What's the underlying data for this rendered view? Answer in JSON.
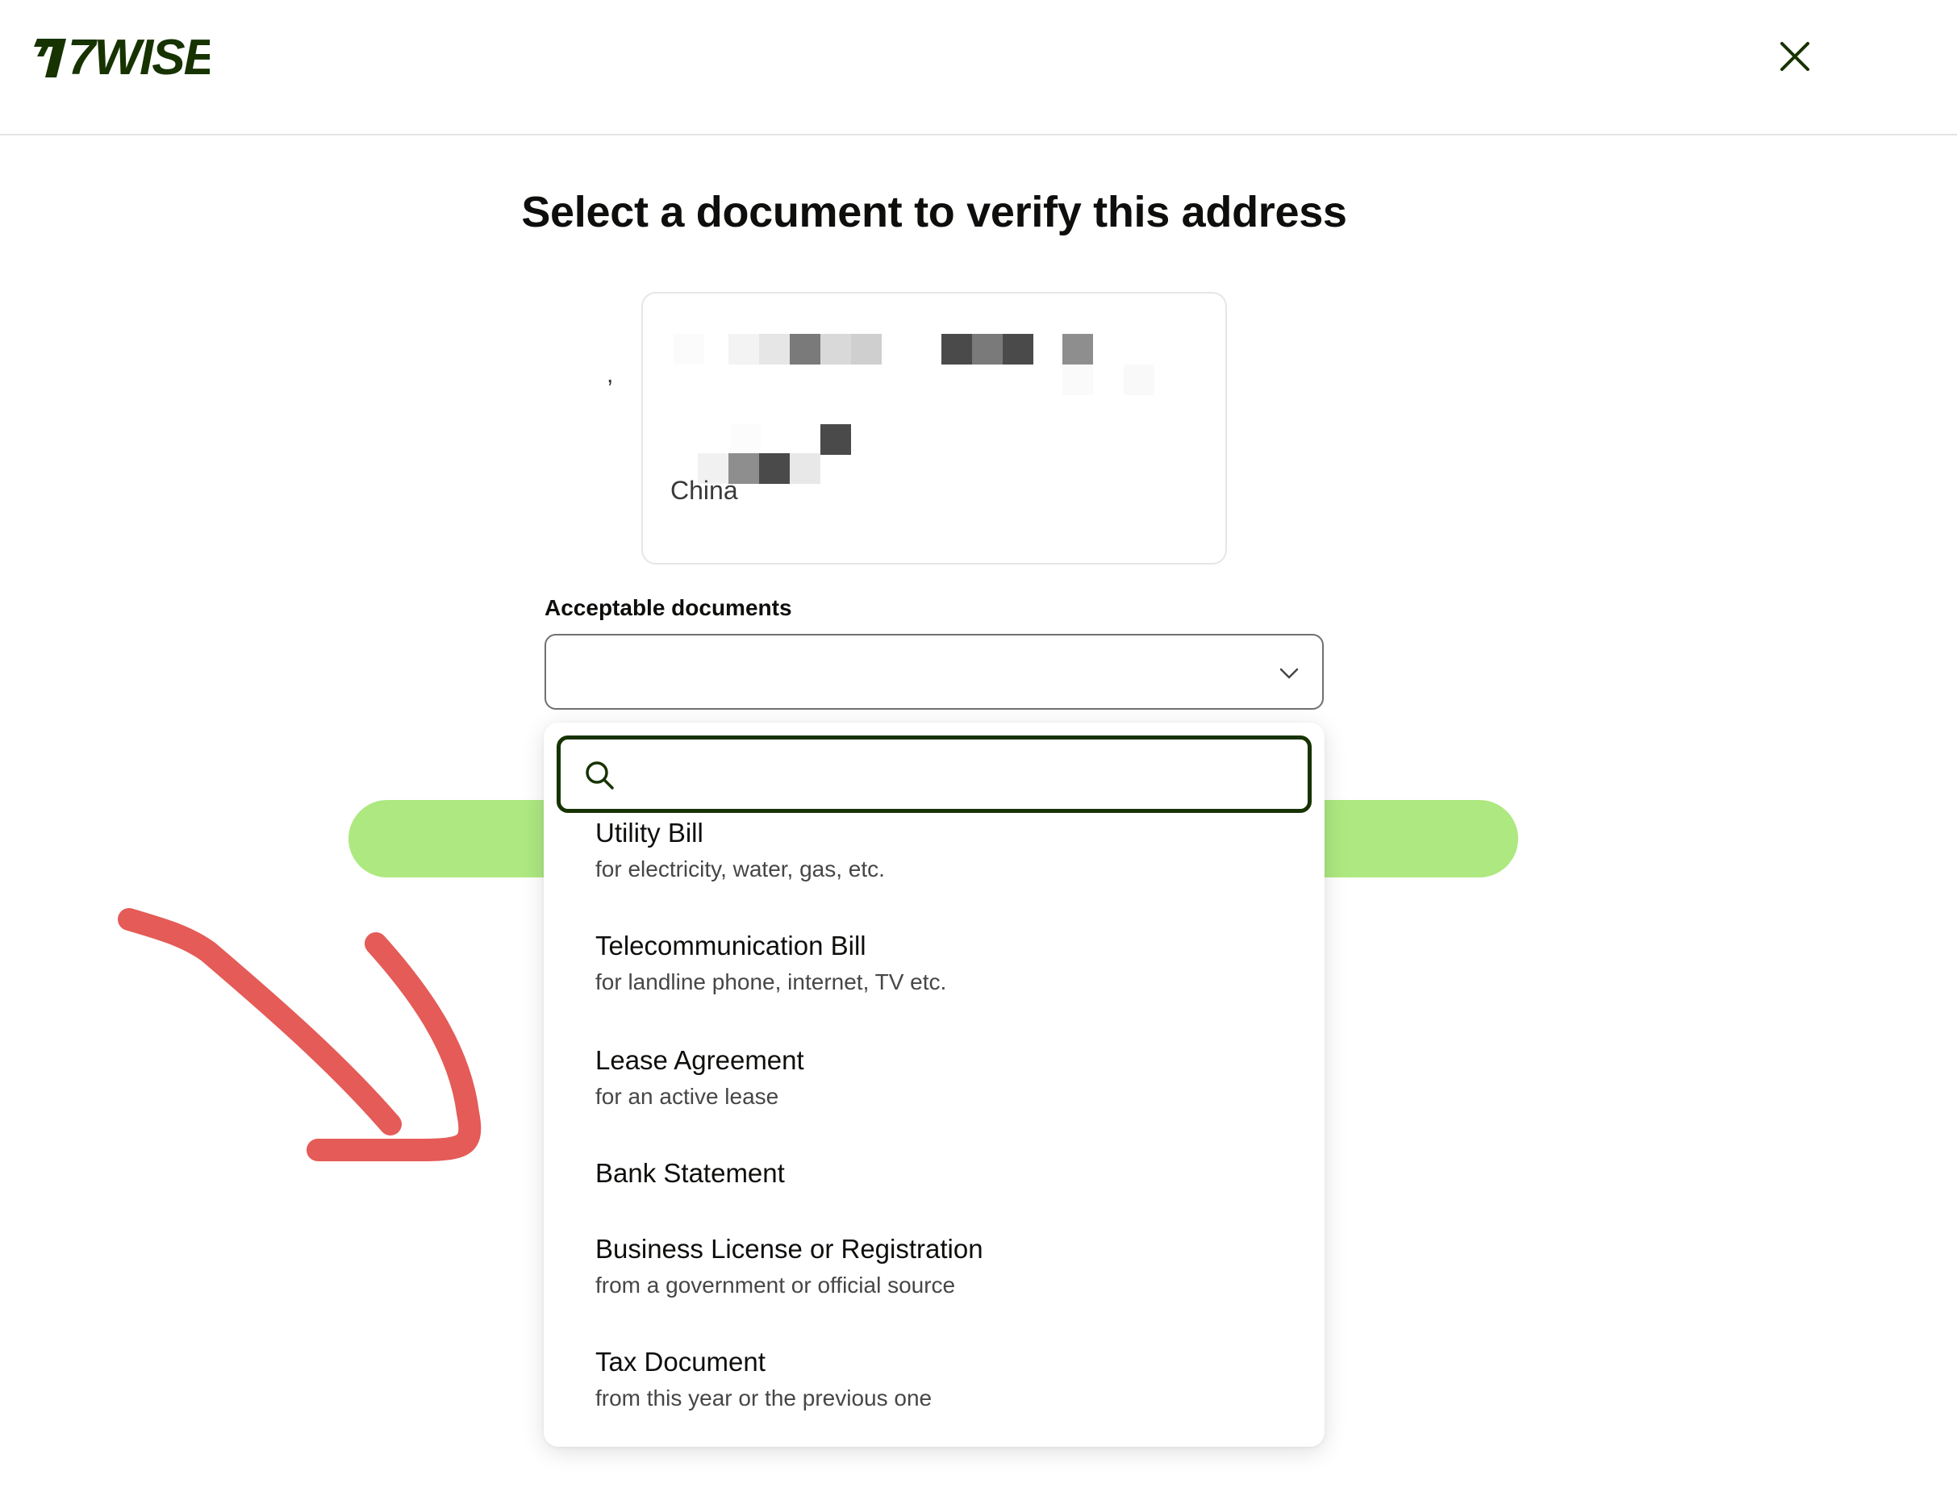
{
  "header": {
    "logo_text": "7WISE",
    "close_label": "×"
  },
  "page": {
    "title": "Select a document to verify this address"
  },
  "address": {
    "country": "China",
    "trailing_comma": ","
  },
  "documents_field": {
    "label": "Acceptable documents",
    "value": ""
  },
  "dropdown": {
    "search_placeholder": "",
    "options": [
      {
        "title": "Utility Bill",
        "subtitle": "for electricity, water, gas, etc."
      },
      {
        "title": "Telecommunication Bill",
        "subtitle": "for landline phone, internet, TV etc."
      },
      {
        "title": "Lease Agreement",
        "subtitle": "for an active lease"
      },
      {
        "title": "Bank Statement",
        "subtitle": ""
      },
      {
        "title": "Business License or Registration",
        "subtitle": "from a government or official source"
      },
      {
        "title": "Tax Document",
        "subtitle": "from this year or the previous one"
      }
    ]
  },
  "colors": {
    "brand_dark": "#163300",
    "brand_green": "#ade880",
    "annotation_arrow": "#e45b57"
  }
}
